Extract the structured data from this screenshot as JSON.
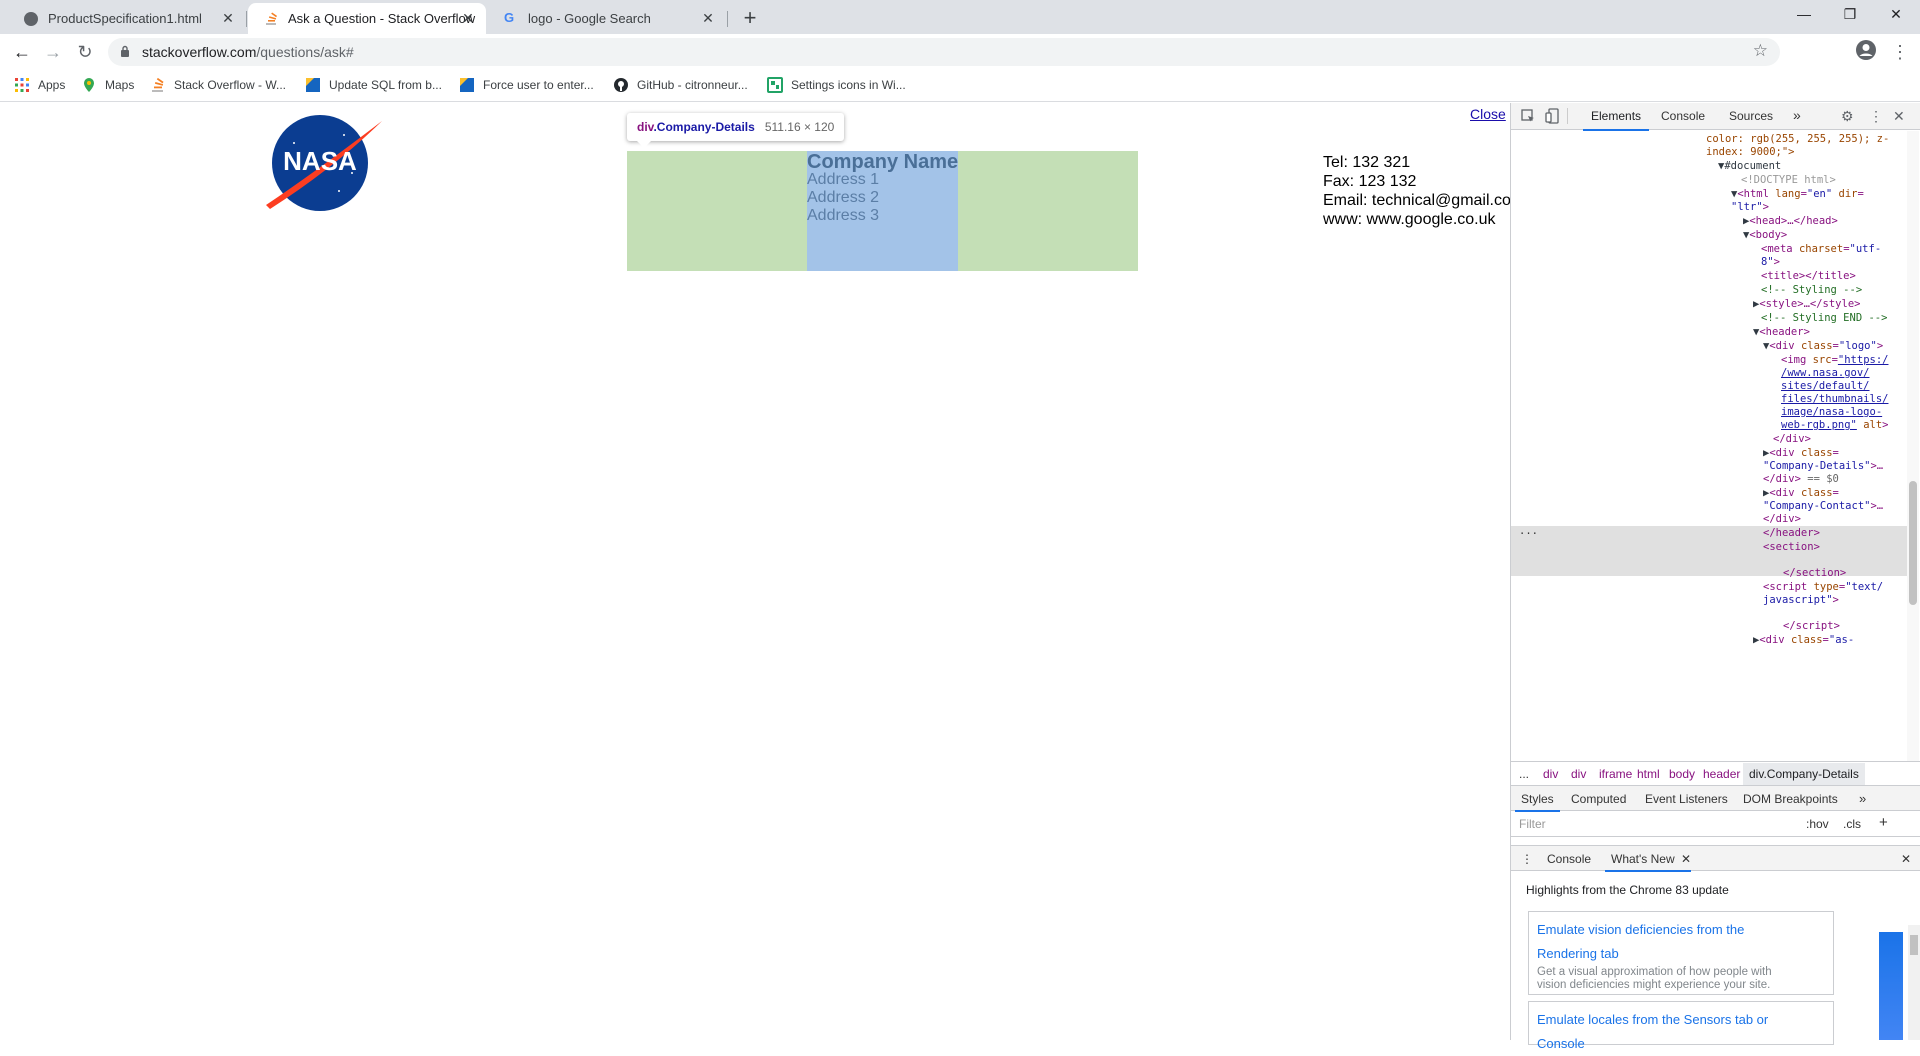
{
  "browser": {
    "tabs": [
      {
        "title": "ProductSpecification1.html",
        "favicon": "globe-icon",
        "active": false
      },
      {
        "title": "Ask a Question - Stack Overflow",
        "favicon": "stackoverflow-icon",
        "active": true
      },
      {
        "title": "logo - Google Search",
        "favicon": "google-icon",
        "active": false
      }
    ],
    "address": {
      "host": "stackoverflow.com",
      "path": "/questions/ask#"
    },
    "bookmarks": [
      {
        "label": "Apps",
        "icon": "apps-grid-icon"
      },
      {
        "label": "Maps",
        "icon": "maps-pin-icon"
      },
      {
        "label": "Stack Overflow - W...",
        "icon": "stackoverflow-icon"
      },
      {
        "label": "Update SQL from b...",
        "icon": "bookmark-blue-icon"
      },
      {
        "label": "Force user to enter...",
        "icon": "bookmark-blue-icon"
      },
      {
        "label": "GitHub - citronneur...",
        "icon": "github-icon"
      },
      {
        "label": "Settings icons in Wi...",
        "icon": "settings-green-icon"
      }
    ]
  },
  "page": {
    "logo_alt": "NASA",
    "tooltip": {
      "tag": "div",
      "class": ".Company-Details",
      "size": "511.16 × 120"
    },
    "company_name": "Company Name",
    "addresses": [
      "Address 1",
      "Address 2",
      "Address 3"
    ],
    "contact": [
      "Tel: 132 321",
      "Fax: 123 132",
      "Email: technical@gmail.co",
      "www: www.google.co.uk"
    ],
    "close_label": "Close"
  },
  "devtools": {
    "tabs": [
      "Elements",
      "Console",
      "Sources",
      "»"
    ],
    "breadcrumbs": [
      "...",
      "div",
      "div",
      "iframe",
      "html",
      "body",
      "header",
      "div.Company-Details"
    ],
    "style_tabs": [
      "Styles",
      "Computed",
      "Event Listeners",
      "DOM Breakpoints",
      "»"
    ],
    "filter_placeholder": "Filter",
    "filter_hov": ":hov",
    "filter_cls": ".cls",
    "drawer_tabs": [
      "Console",
      "What's New"
    ],
    "highlights": "Highlights from the Chrome 83 update",
    "cards": [
      {
        "title_1": "Emulate vision deficiencies from the",
        "title_2": "Rendering tab",
        "desc_1": "Get a visual approximation of how people with",
        "desc_2": "vision deficiencies might experience your site."
      },
      {
        "title_1": "Emulate locales from the Sensors tab or",
        "title_2": "Console"
      }
    ]
  },
  "colors": {
    "highlight_margin": "#c4dfb6",
    "highlight_content": "#a3c3e8",
    "accent": "#1a73e8"
  }
}
